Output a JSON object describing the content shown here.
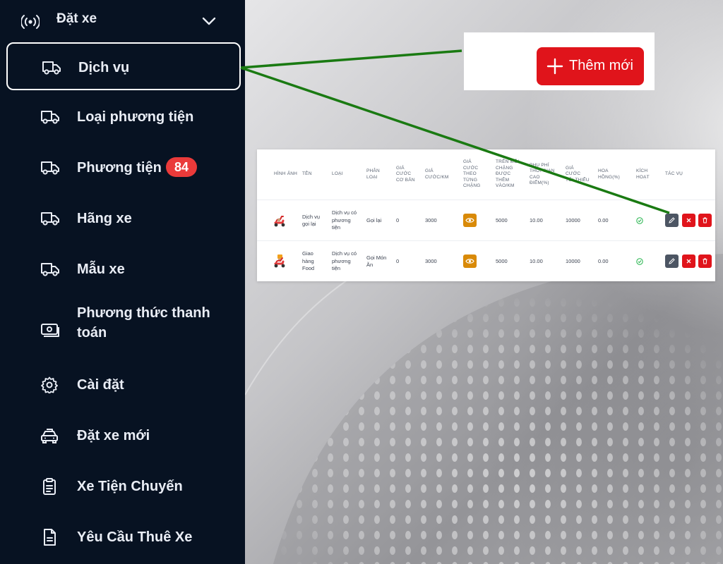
{
  "sidebar": {
    "header": {
      "label": "Đặt xe",
      "icon": "broadcast-icon"
    },
    "items": [
      {
        "label": "Dịch vụ",
        "icon": "truck-icon",
        "active": true
      },
      {
        "label": "Loại phương tiện",
        "icon": "truck-icon"
      },
      {
        "label": "Phương tiện",
        "icon": "truck-icon",
        "badge": "84"
      },
      {
        "label": "Hãng xe",
        "icon": "truck-icon"
      },
      {
        "label": "Mẫu xe",
        "icon": "truck-icon"
      },
      {
        "label": "Phương thức thanh toán",
        "icon": "cash-icon"
      },
      {
        "label": "Cài đặt",
        "icon": "gear-icon"
      },
      {
        "label": "Đặt xe mới",
        "icon": "taxi-icon"
      },
      {
        "label": "Xe Tiện Chuyến",
        "icon": "clipboard-icon"
      },
      {
        "label": "Yêu Cầu Thuê Xe",
        "icon": "document-icon"
      }
    ]
  },
  "toolbar": {
    "add_label": "Thêm mới"
  },
  "table": {
    "headers": [
      "Hình ảnh",
      "Tên",
      "Loại",
      "Phân loại",
      "Giá cước cơ bản",
      "Giá cước/km",
      "Giá cước theo từng chặng",
      "trên mỗi chặng được thêm vào/km",
      "Phụ phí thời gian cao điểm(%)",
      "Giá cước tối thiểu",
      "Hoa hồng(%)",
      "Kích hoạt",
      "Tác vụ"
    ],
    "rows": [
      {
        "name": "Dịch vụ gọi lại",
        "type": "Dịch vụ có phương tiện",
        "category": "Gọi lại",
        "base_fare": "0",
        "fare_per_km": "3000",
        "per_leg": "5000",
        "peak": "10.00",
        "min_fare": "10000",
        "commission": "0.00",
        "image": "scooter-icon"
      },
      {
        "name": "Giao hàng Food",
        "type": "Dịch vụ có phương tiện",
        "category": "Gọi Món Ăn",
        "base_fare": "0",
        "fare_per_km": "3000",
        "per_leg": "5000",
        "peak": "10.00",
        "min_fare": "10000",
        "commission": "0.00",
        "image": "delivery-scooter-icon"
      }
    ]
  },
  "colors": {
    "sidebar_bg": "#071222",
    "primary_red": "#e0141b",
    "badge_red": "#ea3a3a",
    "eye_orange": "#d98a08",
    "annotation_green": "#1a7a12",
    "active_green": "#22b34a"
  }
}
